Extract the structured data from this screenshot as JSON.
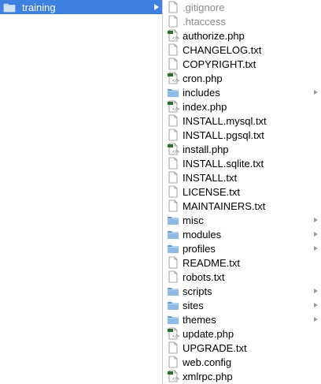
{
  "finder": {
    "selected_folder": "training",
    "items": [
      {
        "name": ".gitignore",
        "kind": "file",
        "hidden": true
      },
      {
        "name": ".htaccess",
        "kind": "file",
        "hidden": true
      },
      {
        "name": "authorize.php",
        "kind": "php"
      },
      {
        "name": "CHANGELOG.txt",
        "kind": "file"
      },
      {
        "name": "COPYRIGHT.txt",
        "kind": "file"
      },
      {
        "name": "cron.php",
        "kind": "php"
      },
      {
        "name": "includes",
        "kind": "folder"
      },
      {
        "name": "index.php",
        "kind": "php"
      },
      {
        "name": "INSTALL.mysql.txt",
        "kind": "file"
      },
      {
        "name": "INSTALL.pgsql.txt",
        "kind": "file"
      },
      {
        "name": "install.php",
        "kind": "php"
      },
      {
        "name": "INSTALL.sqlite.txt",
        "kind": "file"
      },
      {
        "name": "INSTALL.txt",
        "kind": "file"
      },
      {
        "name": "LICENSE.txt",
        "kind": "file"
      },
      {
        "name": "MAINTAINERS.txt",
        "kind": "file"
      },
      {
        "name": "misc",
        "kind": "folder"
      },
      {
        "name": "modules",
        "kind": "folder"
      },
      {
        "name": "profiles",
        "kind": "folder"
      },
      {
        "name": "README.txt",
        "kind": "file"
      },
      {
        "name": "robots.txt",
        "kind": "file"
      },
      {
        "name": "scripts",
        "kind": "folder"
      },
      {
        "name": "sites",
        "kind": "folder"
      },
      {
        "name": "themes",
        "kind": "folder"
      },
      {
        "name": "update.php",
        "kind": "php"
      },
      {
        "name": "UPGRADE.txt",
        "kind": "file"
      },
      {
        "name": "web.config",
        "kind": "file"
      },
      {
        "name": "xmlrpc.php",
        "kind": "php"
      }
    ]
  },
  "colors": {
    "selection": "#3d80df",
    "folder": "#7fb0dc",
    "php_accent": "#2e6b2e"
  }
}
